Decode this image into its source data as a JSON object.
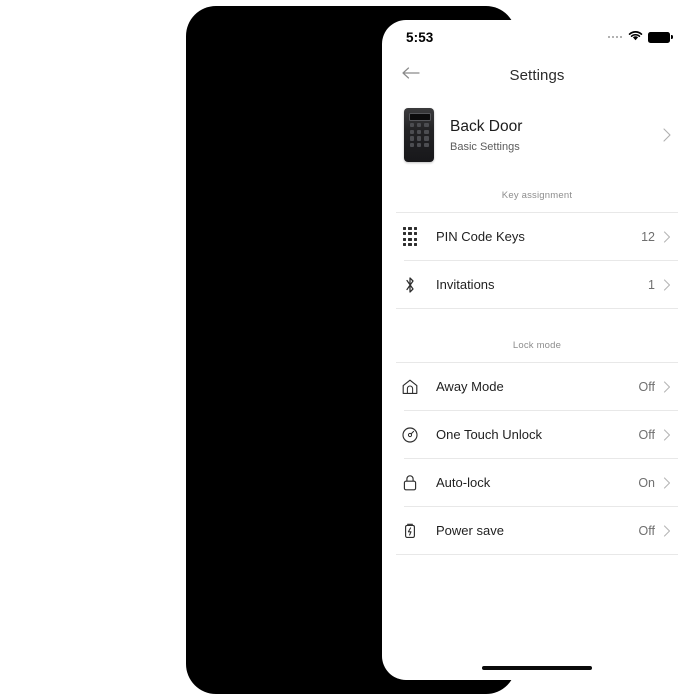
{
  "status_bar": {
    "time": "5:53",
    "signal_icon": "signal-dots-icon",
    "wifi_icon": "wifi-icon",
    "battery_icon": "battery-full-icon"
  },
  "nav": {
    "back_icon": "arrow-left-icon",
    "title": "Settings"
  },
  "device": {
    "icon": "smart-lock-keypad-icon",
    "name": "Back Door",
    "subtitle": "Basic Settings",
    "chevron_icon": "chevron-right-icon"
  },
  "sections": [
    {
      "header": "Key assignment",
      "rows": [
        {
          "icon": "keypad-dots-icon",
          "label": "PIN Code Keys",
          "value": "12",
          "chevron_icon": "chevron-right-icon"
        },
        {
          "icon": "bluetooth-icon",
          "label": "Invitations",
          "value": "1",
          "chevron_icon": "chevron-right-icon"
        }
      ]
    },
    {
      "header": "Lock mode",
      "rows": [
        {
          "icon": "house-icon",
          "label": "Away Mode",
          "value": "Off",
          "chevron_icon": "chevron-right-icon"
        },
        {
          "icon": "one-touch-dial-icon",
          "label": "One Touch Unlock",
          "value": "Off",
          "chevron_icon": "chevron-right-icon"
        },
        {
          "icon": "padlock-icon",
          "label": "Auto-lock",
          "value": "On",
          "chevron_icon": "chevron-right-icon"
        },
        {
          "icon": "battery-bolt-icon",
          "label": "Power save",
          "value": "Off",
          "chevron_icon": "chevron-right-icon"
        }
      ]
    }
  ],
  "home_indicator": "home-indicator",
  "colors": {
    "background": "#ffffff",
    "frame": "#000000",
    "text_primary": "#1f1f1f",
    "text_secondary": "#6f6f6f",
    "section_header": "#8d8d8d",
    "divider": "#e8e8e8",
    "chevron": "#b6b6b6"
  }
}
